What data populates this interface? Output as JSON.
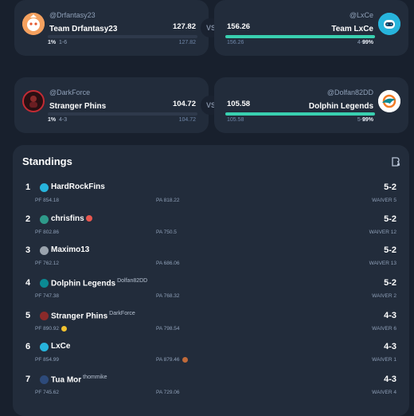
{
  "matchups": [
    {
      "left": {
        "handle": "@Drfantasy23",
        "team": "Team Drfantasy23",
        "score": "127.82",
        "projected": "127.82",
        "win_pct": "1%",
        "record": "1-6",
        "progress": 0.0
      },
      "vs": "VS",
      "right": {
        "handle": "@LxCe",
        "team": "Team LxCe",
        "score": "156.26",
        "projected": "156.26",
        "win_pct": "99%",
        "record": "4-3",
        "progress": 1.0
      }
    },
    {
      "left": {
        "handle": "@DarkForce",
        "team": "Stranger Phins",
        "score": "104.72",
        "projected": "104.72",
        "win_pct": "1%",
        "record": "4-3",
        "progress": 0.0
      },
      "vs": "VS",
      "right": {
        "handle": "@Dolfan82DD",
        "team": "Dolphin Legends",
        "score": "105.58",
        "projected": "105.58",
        "win_pct": "99%",
        "record": "5-2",
        "progress": 1.0
      }
    }
  ],
  "standings": {
    "title": "Standings",
    "rows": [
      {
        "rank": "1",
        "team": "HardRockFins",
        "owner": "",
        "record": "5-2",
        "pf": "PF  854.18",
        "pa": "PA  818.22",
        "waiver": "WAIVER 5"
      },
      {
        "rank": "2",
        "team": "chrisfins",
        "owner": "",
        "record": "5-2",
        "pf": "PF  802.86",
        "pa": "PA  750.5",
        "waiver": "WAIVER 12"
      },
      {
        "rank": "3",
        "team": "Maximo13",
        "owner": "",
        "record": "5-2",
        "pf": "PF  762.12",
        "pa": "PA  686.06",
        "waiver": "WAIVER 13"
      },
      {
        "rank": "4",
        "team": "Dolphin Legends",
        "owner": "Dolfan82DD",
        "record": "5-2",
        "pf": "PF  747.38",
        "pa": "PA  768.32",
        "waiver": "WAIVER 2"
      },
      {
        "rank": "5",
        "team": "Stranger Phins",
        "owner": "DarkForce",
        "record": "4-3",
        "pf": "PF  890.92",
        "pa": "PA  798.54",
        "waiver": "WAIVER 6"
      },
      {
        "rank": "6",
        "team": "LxCe",
        "owner": "",
        "record": "4-3",
        "pf": "PF  854.99",
        "pa": "PA  879.46",
        "waiver": "WAIVER 1"
      },
      {
        "rank": "7",
        "team": "Tua Mor",
        "owner": "thommike",
        "record": "4-3",
        "pf": "PF  745.62",
        "pa": "PA  729.06",
        "waiver": "WAIVER 4"
      }
    ]
  },
  "colors": {
    "background": "#18202d",
    "card": "#222c3b",
    "accent": "#39d0b0"
  },
  "icons": [
    "fire-avatar-icon",
    "robot-avatar-icon",
    "stranger-things-avatar-icon",
    "dolphins-logo-icon",
    "share-icon"
  ]
}
